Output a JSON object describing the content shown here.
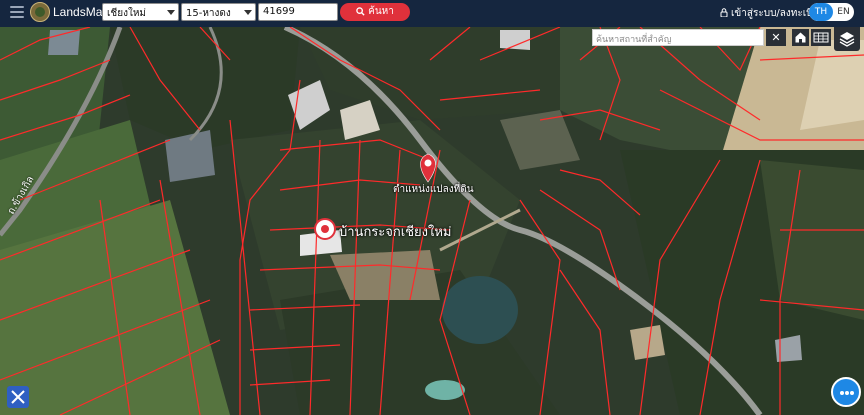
{
  "app": {
    "brand": "LandsMaps"
  },
  "search": {
    "province": "เชียงใหม่",
    "district": "15-หางดง",
    "parcel_number": "41699",
    "button_label": "ค้นหา"
  },
  "header": {
    "login_label": "เข้าสู่ระบบ/ลงทะเบียน",
    "lang_th": "TH",
    "lang_en": "EN"
  },
  "map": {
    "place_search_placeholder": "ค้นหาสถานที่สำคัญ",
    "clear_symbol": "✕",
    "pin_label": "ตำแหน่งแปลงที่ดิน",
    "place_label": "บ้านกระจกเชียงใหม่",
    "road_label": "ถ.ข้างเกิล"
  },
  "colors": {
    "topbar": "#15263f",
    "accent_red": "#e0313b",
    "accent_blue": "#1e88e5",
    "parcel_line": "#ff2a2a"
  }
}
